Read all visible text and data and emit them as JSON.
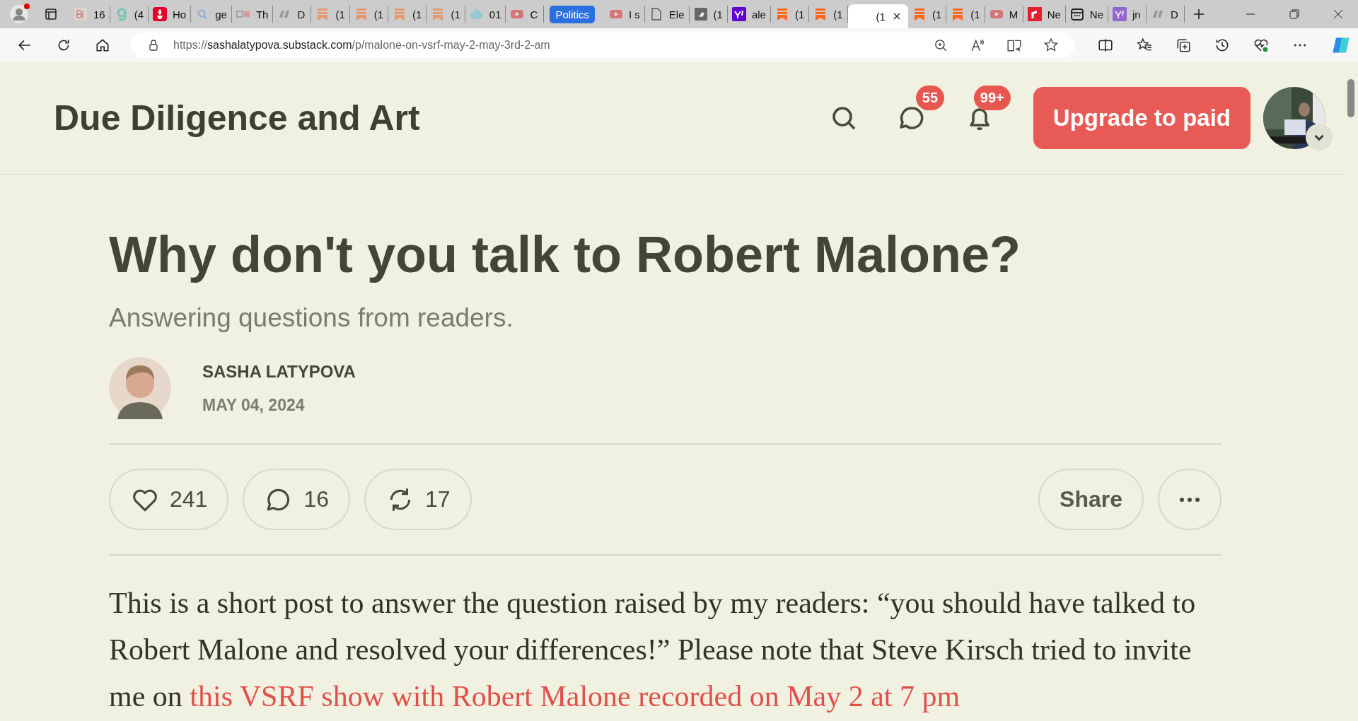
{
  "browser": {
    "tabs": [
      {
        "kind": "bi",
        "label": "16",
        "selected": false,
        "asleep": true
      },
      {
        "kind": "grammarly",
        "label": "(4",
        "selected": false,
        "asleep": true
      },
      {
        "kind": "torch",
        "label": "Ho",
        "selected": false,
        "asleep": false
      },
      {
        "kind": "search",
        "label": "ge",
        "selected": false,
        "asleep": true
      },
      {
        "kind": "ds",
        "label": "Th",
        "selected": false,
        "asleep": true
      },
      {
        "kind": "dr",
        "label": "D",
        "selected": false,
        "asleep": true
      },
      {
        "kind": "substack",
        "label": "(1",
        "selected": false,
        "asleep": true
      },
      {
        "kind": "substack",
        "label": "(1",
        "selected": false,
        "asleep": true
      },
      {
        "kind": "substack",
        "label": "(1",
        "selected": false,
        "asleep": true
      },
      {
        "kind": "substack",
        "label": "(1",
        "selected": false,
        "asleep": true
      },
      {
        "kind": "cloud",
        "label": "01",
        "selected": false,
        "asleep": true
      },
      {
        "kind": "youtube",
        "label": "C",
        "selected": false,
        "asleep": true
      },
      {
        "kind": "group",
        "label": "Politics"
      },
      {
        "kind": "youtube",
        "label": "I s",
        "selected": false,
        "asleep": true
      },
      {
        "kind": "doc",
        "label": "Ele",
        "selected": false,
        "asleep": false
      },
      {
        "kind": "bird",
        "label": "(1",
        "selected": false,
        "asleep": false
      },
      {
        "kind": "yahoo",
        "label": "ale",
        "selected": false,
        "asleep": false
      },
      {
        "kind": "substack",
        "label": "(1",
        "selected": false,
        "asleep": false
      },
      {
        "kind": "substack",
        "label": "(1",
        "selected": false,
        "asleep": false
      },
      {
        "kind": "blank",
        "label": "(1",
        "selected": true,
        "asleep": false
      },
      {
        "kind": "substack",
        "label": "(1",
        "selected": false,
        "asleep": false
      },
      {
        "kind": "substack",
        "label": "(1",
        "selected": false,
        "asleep": false
      },
      {
        "kind": "youtube",
        "label": "M",
        "selected": false,
        "asleep": true
      },
      {
        "kind": "r",
        "label": "Ne",
        "selected": false,
        "asleep": false
      },
      {
        "kind": "calendar",
        "label": "Ne",
        "selected": false,
        "asleep": false
      },
      {
        "kind": "yahoo",
        "label": "jn",
        "selected": false,
        "asleep": true
      },
      {
        "kind": "dr",
        "label": "D",
        "selected": false,
        "asleep": true
      }
    ],
    "address": {
      "scheme": "https://",
      "host": "sashalatypova.substack.com",
      "path": "/p/malone-on-vsrf-may-2-may-3rd-2-am"
    }
  },
  "site": {
    "title": "Due Diligence and Art",
    "chat_badge": "55",
    "notification_badge": "99+",
    "upgrade_button": "Upgrade to paid"
  },
  "post": {
    "title": "Why don't you talk to Robert Malone?",
    "subtitle": "Answering questions from readers.",
    "author": "SASHA LATYPOVA",
    "date": "MAY 04, 2024",
    "likes": "241",
    "comments": "16",
    "restacks": "17",
    "share_button": "Share",
    "body_text": "This is a short post to answer the question raised by my readers: “you should have talked to Robert Malone and resolved your differences!” Please note that Steve Kirsch tried to invite me on ",
    "body_link": "this VSRF show with Robert Malone recorded on May 2 at 7 pm"
  }
}
